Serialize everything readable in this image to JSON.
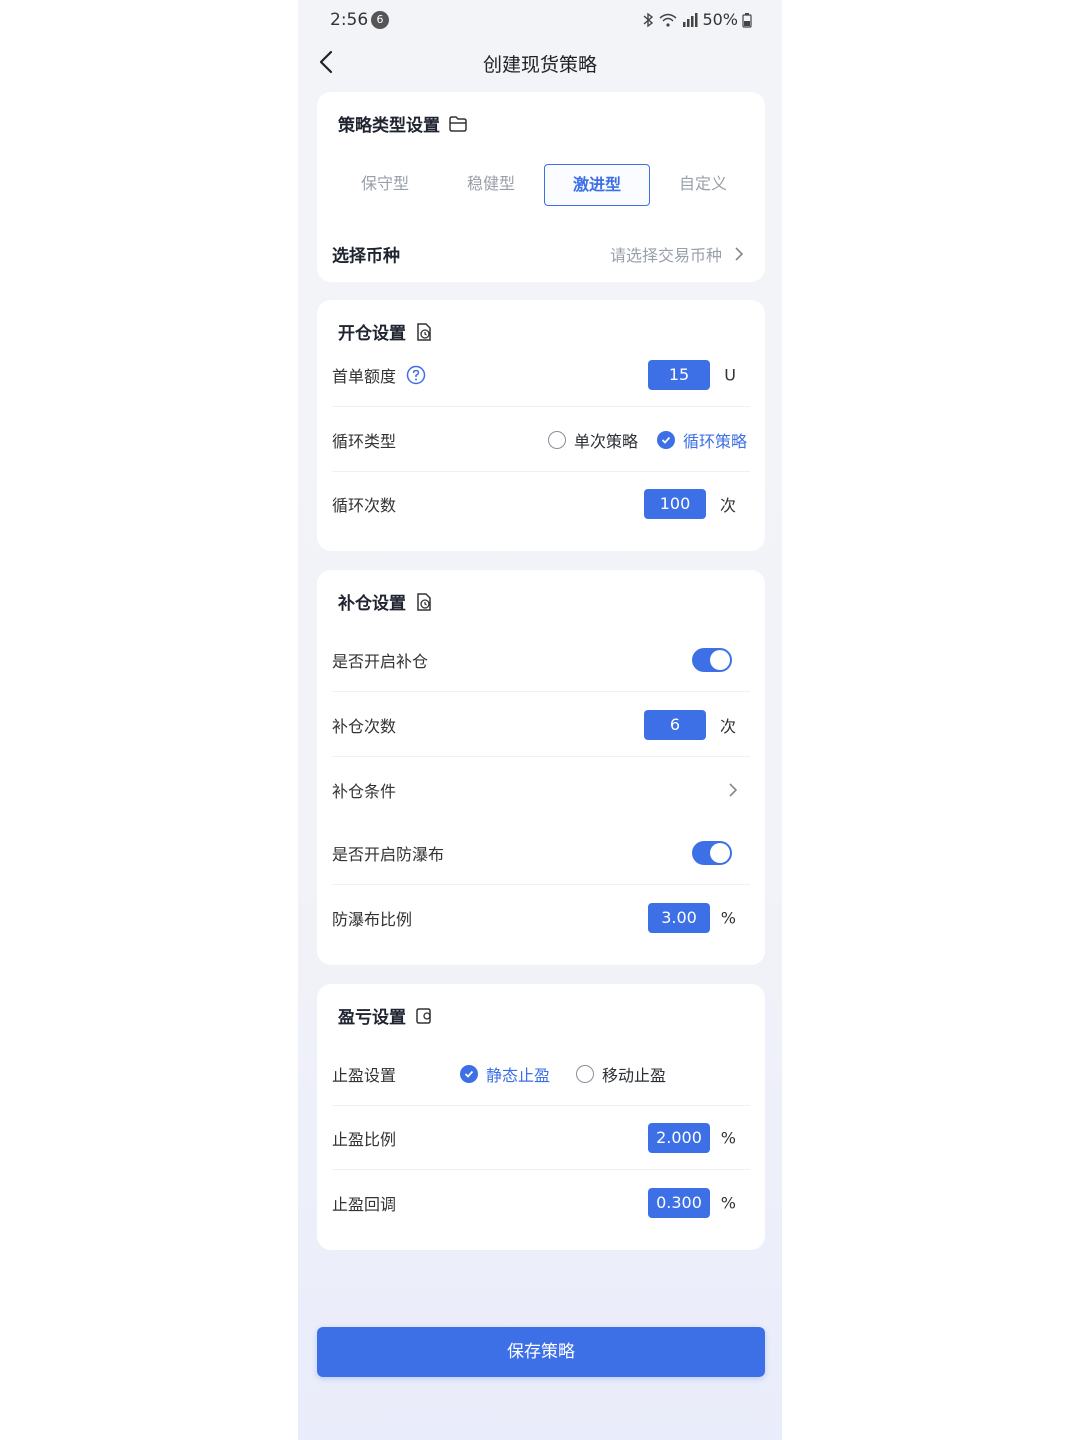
{
  "status_bar": {
    "time": "2:56",
    "notification_count": "6",
    "battery": "50%"
  },
  "header": {
    "title": "创建现货策略"
  },
  "strategy_type": {
    "title": "策略类型设置",
    "tabs": [
      {
        "label": "保守型",
        "active": false
      },
      {
        "label": "稳健型",
        "active": false
      },
      {
        "label": "激进型",
        "active": true
      },
      {
        "label": "自定义",
        "active": false
      }
    ],
    "coin_label": "选择币种",
    "coin_placeholder": "请选择交易币种"
  },
  "open_position": {
    "title": "开仓设置",
    "first_order_label": "首单额度",
    "first_order_value": "15",
    "first_order_unit": "U",
    "loop_type_label": "循环类型",
    "loop_type_options": [
      {
        "label": "单次策略",
        "selected": false
      },
      {
        "label": "循环策略",
        "selected": true
      }
    ],
    "loop_count_label": "循环次数",
    "loop_count_value": "100",
    "loop_count_unit": "次"
  },
  "add_position": {
    "title": "补仓设置",
    "enable_label": "是否开启补仓",
    "enable_on": true,
    "count_label": "补仓次数",
    "count_value": "6",
    "count_unit": "次",
    "condition_label": "补仓条件",
    "waterfall_label": "是否开启防瀑布",
    "waterfall_on": true,
    "waterfall_ratio_label": "防瀑布比例",
    "waterfall_ratio_value": "3.00",
    "waterfall_ratio_unit": "%"
  },
  "profit_loss": {
    "title": "盈亏设置",
    "take_profit_label": "止盈设置",
    "take_profit_options": [
      {
        "label": "静态止盈",
        "selected": true
      },
      {
        "label": "移动止盈",
        "selected": false
      }
    ],
    "take_profit_ratio_label": "止盈比例",
    "take_profit_ratio_value": "2.000",
    "take_profit_ratio_unit": "%",
    "pullback_label": "止盈回调",
    "pullback_value": "0.300",
    "pullback_unit": "%"
  },
  "footer": {
    "save_label": "保存策略"
  },
  "colors": {
    "accent": "#3d6fe6",
    "background": "#f3f4f8",
    "card": "#ffffff"
  }
}
